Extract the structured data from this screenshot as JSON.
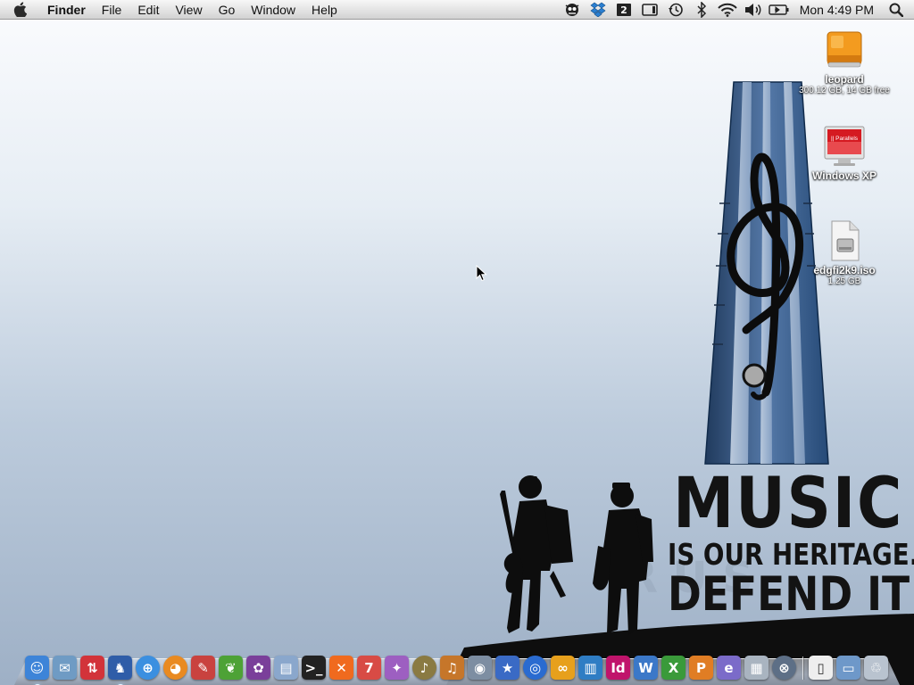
{
  "menubar": {
    "app_name": "Finder",
    "menus": [
      "File",
      "Edit",
      "View",
      "Go",
      "Window",
      "Help"
    ],
    "space_number": "2",
    "clock": "Mon 4:49 PM",
    "status_icons": [
      "bug-monitor-icon",
      "dropbox-icon",
      "spaces-icon",
      "display-icon",
      "time-machine-icon",
      "bluetooth-icon",
      "wifi-icon",
      "volume-icon",
      "battery-icon",
      "spotlight-icon"
    ]
  },
  "wallpaper": {
    "line1": "MUSIC",
    "line2": "IS OUR HERITAGE.",
    "line3": "DEFEND IT"
  },
  "desktop_icons": [
    {
      "name": "leopard",
      "sub": "300.12 GB, 14 GB free",
      "icon": "hard-drive-icon"
    },
    {
      "name": "Windows XP",
      "sub": "",
      "icon": "parallels-vm-icon",
      "badge": "|| Parallels"
    },
    {
      "name": "edgfi2k9.iso",
      "sub": "1.25 GB",
      "icon": "disk-image-icon"
    }
  ],
  "dock": {
    "apps": [
      {
        "icon": "finder-icon",
        "glyph": "☺",
        "color": "#3d84d8",
        "running": true
      },
      {
        "icon": "mail-icon",
        "glyph": "✉",
        "color": "#6f9bc4",
        "running": false
      },
      {
        "icon": "transmit-icon",
        "glyph": "⇅",
        "color": "#d2333a",
        "running": false
      },
      {
        "icon": "adium-icon",
        "glyph": "♞",
        "color": "#2f5da8",
        "running": true
      },
      {
        "icon": "safari-icon",
        "glyph": "⊕",
        "color": "#3b8fe0",
        "running": false
      },
      {
        "icon": "firefox-icon",
        "glyph": "◕",
        "color": "#e98a21",
        "running": false
      },
      {
        "icon": "cssedit-icon",
        "glyph": "✎",
        "color": "#c9423f",
        "running": false
      },
      {
        "icon": "coda-icon",
        "glyph": "❦",
        "color": "#4da236",
        "running": false
      },
      {
        "icon": "textmate-icon",
        "glyph": "✿",
        "color": "#7a3f9a",
        "running": false
      },
      {
        "icon": "sequel-pro-icon",
        "glyph": "▤",
        "color": "#8aa7cc",
        "running": false
      },
      {
        "icon": "terminal-icon",
        "glyph": ">_",
        "color": "#222222",
        "running": false
      },
      {
        "icon": "xampp-icon",
        "glyph": "✕",
        "color": "#f06a1e",
        "running": false
      },
      {
        "icon": "ical-icon",
        "glyph": "7",
        "color": "#d84b45",
        "running": false
      },
      {
        "icon": "chat-bubble-icon",
        "glyph": "✦",
        "color": "#9d5fc1",
        "running": false
      },
      {
        "icon": "itunes-icon",
        "glyph": "♪",
        "color": "#8a7a42",
        "running": false
      },
      {
        "icon": "garageband-icon",
        "glyph": "♫",
        "color": "#c6762a",
        "running": false
      },
      {
        "icon": "iphoto-icon",
        "glyph": "◉",
        "color": "#7d8ea2",
        "running": false
      },
      {
        "icon": "imovie-icon",
        "glyph": "★",
        "color": "#3a6ac5",
        "running": false
      },
      {
        "icon": "dvd-player-icon",
        "glyph": "◎",
        "color": "#2a6bd0",
        "running": false
      },
      {
        "icon": "linkage-icon",
        "glyph": "∞",
        "color": "#e7a01c",
        "running": false
      },
      {
        "icon": "books-icon",
        "glyph": "▥",
        "color": "#2f7dc4",
        "running": false
      },
      {
        "icon": "indesign-icon",
        "glyph": "Id",
        "color": "#c0146b",
        "running": false
      },
      {
        "icon": "word-icon",
        "glyph": "W",
        "color": "#3b78c8",
        "running": false
      },
      {
        "icon": "excel-icon",
        "glyph": "X",
        "color": "#3a9a3a",
        "running": false
      },
      {
        "icon": "powerpoint-icon",
        "glyph": "P",
        "color": "#e07d24",
        "running": false
      },
      {
        "icon": "entourage-icon",
        "glyph": "e",
        "color": "#7b6bc9",
        "running": false
      },
      {
        "icon": "calculator-icon",
        "glyph": "▦",
        "color": "#a9b4c0",
        "running": false
      },
      {
        "icon": "network-globe-icon",
        "glyph": "⊗",
        "color": "#5d6f86",
        "running": false
      }
    ],
    "stacks": [
      {
        "icon": "document-stack-icon",
        "glyph": "▯",
        "color": "#eeeeee"
      },
      {
        "icon": "folder-stack-icon",
        "glyph": "▭",
        "color": "#6e98c9"
      },
      {
        "icon": "trash-icon",
        "glyph": "♲",
        "color": "#b9c3cf"
      }
    ]
  }
}
